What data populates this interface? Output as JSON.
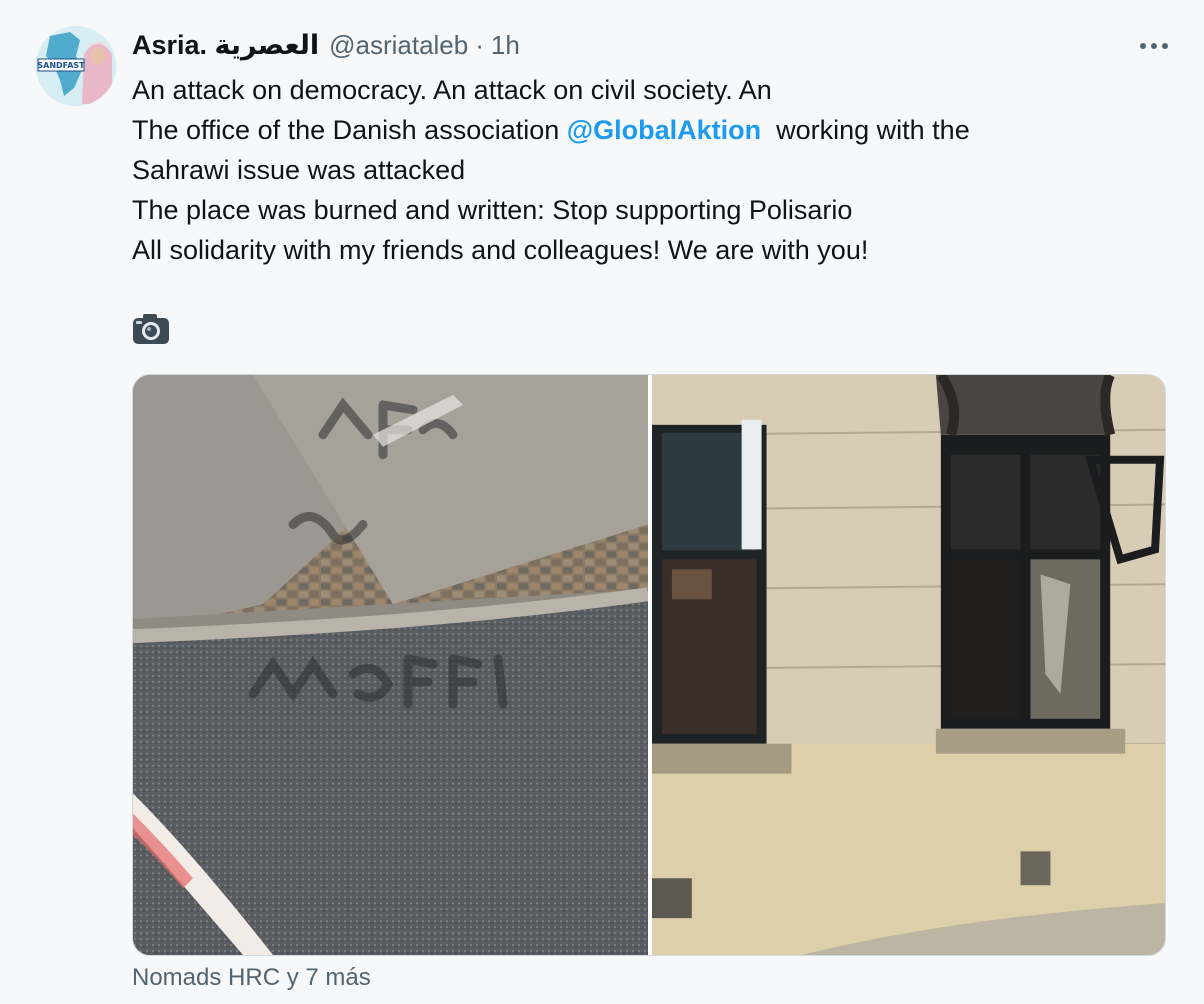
{
  "tweet": {
    "author": {
      "display_name": "Asria. العصرية",
      "handle": "@asriataleb",
      "avatar_label": "SANDFAST"
    },
    "separator": "·",
    "time": "1h",
    "more_icon": "more-horizontal-icon",
    "text_lines": [
      "An attack on democracy. An attack on civil society. An",
      "The office of the Danish association",
      "working with the",
      "Sahrawi issue was attacked",
      "The place was burned and written: Stop supporting Polisario",
      "All solidarity with my friends and colleagues! We are with you!"
    ],
    "mention": "@GlobalAktion",
    "camera_icon": "camera-icon",
    "media": [
      {
        "icon": "photo-graffiti-pavement"
      },
      {
        "icon": "photo-burned-window"
      }
    ],
    "social_context": "Nomads HRC y 7 más"
  },
  "colors": {
    "accent": "#1d9bf0",
    "text": "#0f1419",
    "secondary": "#536471",
    "background": "#f7f8f9"
  }
}
